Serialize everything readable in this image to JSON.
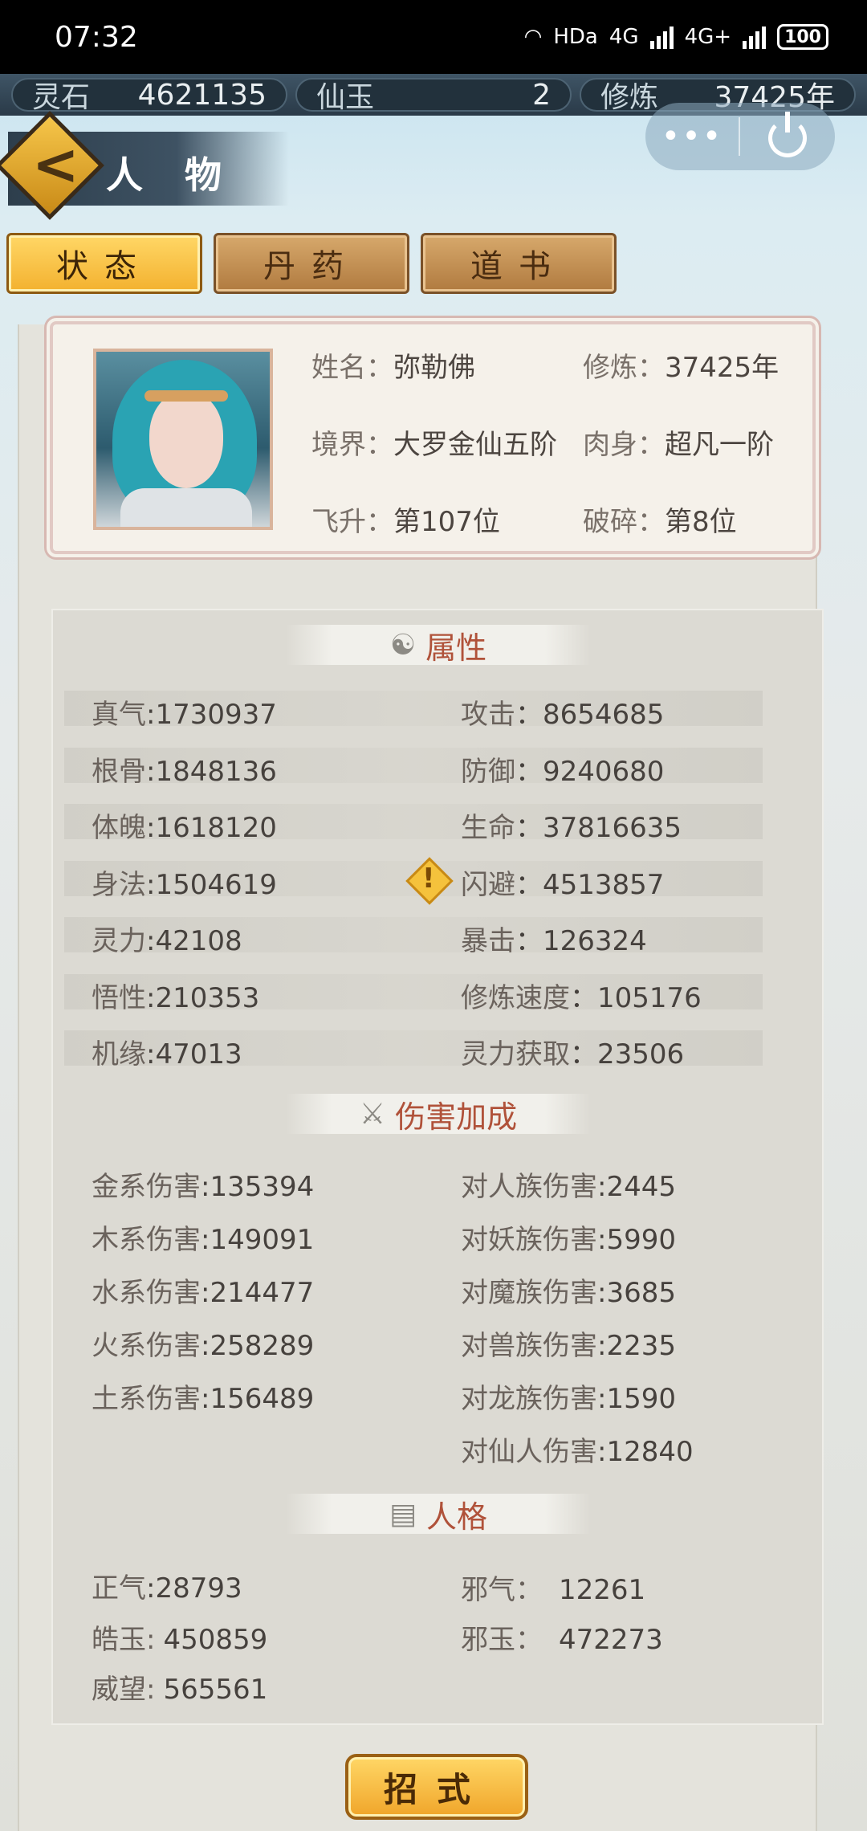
{
  "status_bar": {
    "time": "07:32",
    "network": "HDa",
    "signal1": "4G",
    "signal2": "4G+",
    "battery": "100"
  },
  "resources": [
    {
      "label": "灵石",
      "value": "4621135"
    },
    {
      "label": "仙玉",
      "value": "2"
    },
    {
      "label": "修炼",
      "value": "37425年"
    }
  ],
  "header": {
    "title": "人 物",
    "more": "•••"
  },
  "tabs": [
    {
      "label": "状态",
      "active": true
    },
    {
      "label": "丹药",
      "active": false
    },
    {
      "label": "道书",
      "active": false
    }
  ],
  "profile": {
    "name_k": "姓名：",
    "name_v": "弥勒佛",
    "cult_k": "修炼：",
    "cult_v": "37425年",
    "realm_k": "境界：",
    "realm_v": "大罗金仙五阶",
    "body_k": "肉身：",
    "body_v": "超凡一阶",
    "ascend_k": "飞升：",
    "ascend_v": "第107位",
    "shatter_k": "破碎：",
    "shatter_v": "第8位"
  },
  "sections": {
    "attributes": "属性",
    "damage": "伤害加成",
    "personality": "人格"
  },
  "attributes": {
    "left": [
      {
        "k": "真气",
        "v": ":1730937"
      },
      {
        "k": "根骨",
        "v": ":1848136"
      },
      {
        "k": "体魄",
        "v": ":1618120"
      },
      {
        "k": "身法",
        "v": ":1504619"
      },
      {
        "k": "灵力",
        "v": ":42108"
      },
      {
        "k": "悟性",
        "v": ":210353"
      },
      {
        "k": "机缘",
        "v": ":47013"
      }
    ],
    "right": [
      {
        "k": "攻击",
        "v": "：8654685"
      },
      {
        "k": "防御",
        "v": "：9240680"
      },
      {
        "k": "生命",
        "v": "：37816635"
      },
      {
        "k": "闪避",
        "v": "：4513857"
      },
      {
        "k": "暴击",
        "v": "：126324"
      },
      {
        "k": "修炼速度",
        "v": "：105176"
      },
      {
        "k": "灵力获取",
        "v": "：23506"
      }
    ]
  },
  "damage": {
    "left": [
      {
        "k": "金系伤害",
        "v": ":135394"
      },
      {
        "k": "木系伤害",
        "v": ":149091"
      },
      {
        "k": "水系伤害",
        "v": ":214477"
      },
      {
        "k": "火系伤害",
        "v": ":258289"
      },
      {
        "k": "土系伤害",
        "v": ":156489"
      }
    ],
    "right": [
      {
        "k": "对人族伤害",
        "v": ":2445"
      },
      {
        "k": "对妖族伤害",
        "v": ":5990"
      },
      {
        "k": "对魔族伤害",
        "v": ":3685"
      },
      {
        "k": "对兽族伤害",
        "v": ":2235"
      },
      {
        "k": "对龙族伤害",
        "v": ":1590"
      },
      {
        "k": "对仙人伤害",
        "v": ":12840"
      }
    ]
  },
  "personality": {
    "zhengqi_k": "正气",
    "zhengqi_v": ":28793",
    "xieqi_k": "邪气：",
    "xieqi_v": "12261",
    "haoyu_k": "皓玉:",
    "haoyu_v": "450859",
    "xieyu_k": "邪玉：",
    "xieyu_v": "472273",
    "weiwang_k": "威望:",
    "weiwang_v": "565561"
  },
  "skill_button": "招式"
}
